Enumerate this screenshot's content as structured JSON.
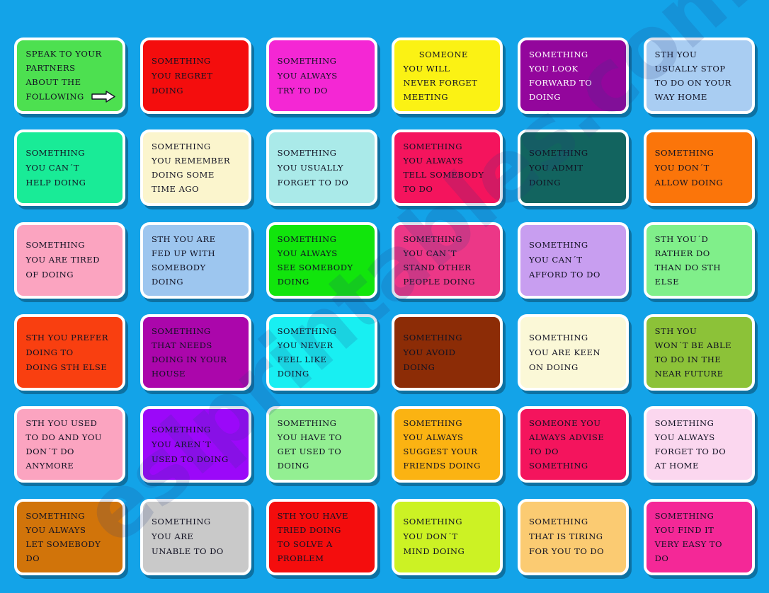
{
  "page": {
    "background_color": "#13a3e8",
    "card_border_color": "#ffffff",
    "watermark_text": "eslprintables.com",
    "arrow_icon": "right-arrow-icon"
  },
  "cards": [
    {
      "id": "card-1",
      "bg": "#4de050",
      "text_color": "#111122",
      "has_arrow": true,
      "lines": [
        "SPEAK TO YOUR",
        "PARTNERS",
        "ABOUT THE",
        "FOLLOWING"
      ]
    },
    {
      "id": "card-2",
      "bg": "#f40d0d",
      "text_color": "#111122",
      "has_arrow": false,
      "lines": [
        "SOMETHING",
        "YOU REGRET",
        "DOING"
      ]
    },
    {
      "id": "card-3",
      "bg": "#f427d4",
      "text_color": "#111122",
      "has_arrow": false,
      "lines": [
        "SOMETHING",
        "YOU ALWAYS",
        "TRY TO DO"
      ]
    },
    {
      "id": "card-4",
      "bg": "#fbf214",
      "text_color": "#111122",
      "has_arrow": false,
      "center_first": true,
      "lines": [
        "SOMEONE",
        "YOU WILL",
        "NEVER FORGET",
        "MEETING"
      ]
    },
    {
      "id": "card-5",
      "bg": "#93069c",
      "text_color": "#ffffff",
      "has_arrow": false,
      "lines": [
        "SOMETHING",
        "YOU LOOK",
        "FORWARD TO",
        "DOING"
      ]
    },
    {
      "id": "card-6",
      "bg": "#a9cdf2",
      "text_color": "#111122",
      "has_arrow": false,
      "lines": [
        "STH YOU",
        "USUALLY STOP",
        "TO DO ON YOUR",
        "WAY HOME"
      ]
    },
    {
      "id": "card-7",
      "bg": "#19eb97",
      "text_color": "#111122",
      "has_arrow": false,
      "lines": [
        "SOMETHING",
        "YOU CAN´T",
        "HELP DOING"
      ]
    },
    {
      "id": "card-8",
      "bg": "#fbf5cd",
      "text_color": "#111122",
      "has_arrow": false,
      "lines": [
        "SOMETHING",
        "YOU REMEMBER",
        "DOING SOME",
        "TIME AGO"
      ]
    },
    {
      "id": "card-9",
      "bg": "#aaeae9",
      "text_color": "#111122",
      "has_arrow": false,
      "lines": [
        "SOMETHING",
        "YOU USUALLY",
        "FORGET TO DO"
      ]
    },
    {
      "id": "card-10",
      "bg": "#f4145d",
      "text_color": "#111122",
      "has_arrow": false,
      "lines": [
        "SOMETHING",
        "YOU ALWAYS",
        "TELL SOMEBODY",
        "TO DO"
      ]
    },
    {
      "id": "card-11",
      "bg": "#12645f",
      "text_color": "#111122",
      "has_arrow": false,
      "lines": [
        "SOMETHING",
        "YOU ADMIT",
        "DOING"
      ]
    },
    {
      "id": "card-12",
      "bg": "#fb750a",
      "text_color": "#111122",
      "has_arrow": false,
      "lines": [
        "SOMETHING",
        "YOU DON´T",
        "ALLOW DOING"
      ]
    },
    {
      "id": "card-13",
      "bg": "#fba4c0",
      "text_color": "#111122",
      "has_arrow": false,
      "lines": [
        "SOMETHING",
        "YOU ARE TIRED",
        "OF DOING"
      ]
    },
    {
      "id": "card-14",
      "bg": "#9dc6ef",
      "text_color": "#111122",
      "has_arrow": false,
      "lines": [
        "STH YOU ARE",
        "FED UP WITH",
        "SOMEBODY",
        "DOING"
      ]
    },
    {
      "id": "card-15",
      "bg": "#11e50c",
      "text_color": "#111122",
      "has_arrow": false,
      "lines": [
        "SOMETHING",
        "YOU ALWAYS",
        "SEE SOMEBODY",
        "DOING"
      ]
    },
    {
      "id": "card-16",
      "bg": "#ec3787",
      "text_color": "#111122",
      "has_arrow": false,
      "lines": [
        "SOMETHING",
        "YOU CAN´T",
        "STAND OTHER",
        "PEOPLE DOING"
      ]
    },
    {
      "id": "card-17",
      "bg": "#c89ef0",
      "text_color": "#111122",
      "has_arrow": false,
      "lines": [
        "SOMETHING",
        "YOU CAN´T",
        "AFFORD TO DO"
      ]
    },
    {
      "id": "card-18",
      "bg": "#80ef8a",
      "text_color": "#111122",
      "has_arrow": false,
      "lines": [
        "STH YOU´D",
        "RATHER DO",
        "THAN DO STH",
        "ELSE"
      ]
    },
    {
      "id": "card-19",
      "bg": "#f93f10",
      "text_color": "#111122",
      "has_arrow": false,
      "lines": [
        "STH YOU PREFER",
        "DOING TO",
        "DOING STH ELSE"
      ]
    },
    {
      "id": "card-20",
      "bg": "#ab06ab",
      "text_color": "#111122",
      "has_arrow": false,
      "lines": [
        "SOMETHING",
        "THAT NEEDS",
        "DOING IN YOUR",
        "HOUSE"
      ]
    },
    {
      "id": "card-21",
      "bg": "#18eff2",
      "text_color": "#111122",
      "has_arrow": false,
      "lines": [
        "SOMETHING",
        "YOU NEVER",
        "FEEL LIKE",
        "DOING"
      ]
    },
    {
      "id": "card-22",
      "bg": "#8c2c06",
      "text_color": "#111122",
      "has_arrow": false,
      "lines": [
        "SOMETHING",
        "YOU AVOID",
        "DOING"
      ]
    },
    {
      "id": "card-23",
      "bg": "#fbf8d7",
      "text_color": "#111122",
      "has_arrow": false,
      "lines": [
        "SOMETHING",
        "YOU ARE KEEN",
        "ON DOING"
      ]
    },
    {
      "id": "card-24",
      "bg": "#8cc238",
      "text_color": "#111122",
      "has_arrow": false,
      "lines": [
        "STH YOU",
        "WON´T BE ABLE",
        "TO DO IN THE",
        "NEAR FUTURE"
      ]
    },
    {
      "id": "card-25",
      "bg": "#fba4c0",
      "text_color": "#111122",
      "has_arrow": false,
      "lines": [
        "STH YOU USED",
        "TO DO AND YOU",
        "DON´T DO",
        "ANYMORE"
      ]
    },
    {
      "id": "card-26",
      "bg": "#9b08f9",
      "text_color": "#111122",
      "has_arrow": false,
      "lines": [
        "SOMETHING",
        "YOU AREN´T",
        "USED TO DOING"
      ]
    },
    {
      "id": "card-27",
      "bg": "#93ef92",
      "text_color": "#111122",
      "has_arrow": false,
      "lines": [
        "SOMETHING",
        "YOU HAVE TO",
        "GET USED TO",
        "DOING"
      ]
    },
    {
      "id": "card-28",
      "bg": "#fbb312",
      "text_color": "#111122",
      "has_arrow": false,
      "lines": [
        "SOMETHING",
        "YOU ALWAYS",
        "SUGGEST YOUR",
        "FRIENDS DOING"
      ]
    },
    {
      "id": "card-29",
      "bg": "#f4145d",
      "text_color": "#111122",
      "has_arrow": false,
      "lines": [
        "SOMEONE YOU",
        "ALWAYS ADVISE",
        "TO DO",
        "SOMETHING"
      ]
    },
    {
      "id": "card-30",
      "bg": "#fbd7ef",
      "text_color": "#111122",
      "has_arrow": false,
      "lines": [
        "SOMETHING",
        "YOU ALWAYS",
        "FORGET TO DO",
        "AT HOME"
      ]
    },
    {
      "id": "card-31",
      "bg": "#d1740a",
      "text_color": "#111122",
      "has_arrow": false,
      "lines": [
        "SOMETHING",
        "YOU ALWAYS",
        "LET SOMEBODY",
        "DO"
      ]
    },
    {
      "id": "card-32",
      "bg": "#c9c9c9",
      "text_color": "#111122",
      "has_arrow": false,
      "lines": [
        "SOMETHING",
        "YOU ARE",
        "UNABLE TO DO"
      ]
    },
    {
      "id": "card-33",
      "bg": "#f40d0d",
      "text_color": "#111122",
      "has_arrow": false,
      "lines": [
        "STH YOU HAVE",
        "TRIED DOING",
        "TO SOLVE A",
        "PROBLEM"
      ]
    },
    {
      "id": "card-34",
      "bg": "#ccf224",
      "text_color": "#111122",
      "has_arrow": false,
      "lines": [
        "SOMETHING",
        "YOU DON´T",
        "MIND DOING"
      ]
    },
    {
      "id": "card-35",
      "bg": "#fbcb72",
      "text_color": "#111122",
      "has_arrow": false,
      "lines": [
        "SOMETHING",
        "THAT IS TIRING",
        "FOR YOU TO DO"
      ]
    },
    {
      "id": "card-36",
      "bg": "#f42897",
      "text_color": "#111122",
      "has_arrow": false,
      "lines": [
        "SOMETHING",
        "YOU FIND IT",
        "VERY EASY TO",
        "DO"
      ]
    }
  ]
}
